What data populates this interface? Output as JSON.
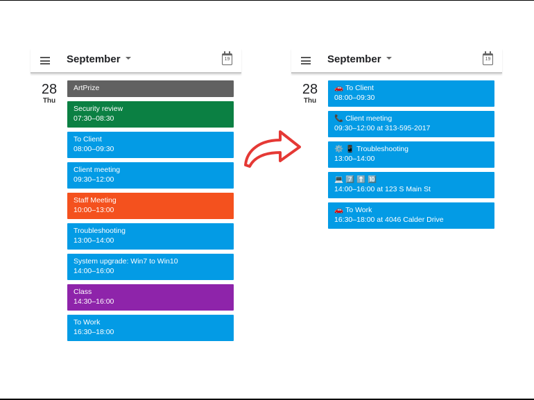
{
  "colors": {
    "graphite": "#616161",
    "basil": "#0b8043",
    "peacock": "#039be5",
    "tangerine": "#f4511e",
    "grape": "#8e24aa",
    "arrow": "#e53935"
  },
  "left": {
    "header": {
      "month": "September",
      "calendar_icon_day": "19"
    },
    "day": {
      "number": "28",
      "name": "Thu"
    },
    "events": [
      {
        "title": "ArtPrize",
        "time": "",
        "color": "#616161"
      },
      {
        "title": "Security review",
        "time": "07:30–08:30",
        "color": "#0b8043"
      },
      {
        "title": "To Client",
        "time": "08:00–09:30",
        "color": "#039be5"
      },
      {
        "title": "Client meeting",
        "time": "09:30–12:00",
        "color": "#039be5"
      },
      {
        "title": "Staff Meeting",
        "time": "10:00–13:00",
        "color": "#f4511e"
      },
      {
        "title": "Troubleshooting",
        "time": "13:00–14:00",
        "color": "#039be5"
      },
      {
        "title": "System upgrade: Win7 to Win10",
        "time": "14:00–16:00",
        "color": "#039be5"
      },
      {
        "title": "Class",
        "time": "14:30–16:00",
        "color": "#8e24aa"
      },
      {
        "title": "To Work",
        "time": "16:30–18:00",
        "color": "#039be5"
      }
    ]
  },
  "right": {
    "header": {
      "month": "September",
      "calendar_icon_day": "19"
    },
    "day": {
      "number": "28",
      "name": "Thu"
    },
    "events": [
      {
        "icons": "🚗",
        "title": "To Client",
        "time": "08:00–09:30",
        "color": "#039be5"
      },
      {
        "icons": "📞",
        "title": "Client meeting",
        "time": "09:30–12:00 at 313-595-2017",
        "color": "#039be5"
      },
      {
        "icons": "⚙️ 📱",
        "title": "Troubleshooting",
        "time": "13:00–14:00",
        "color": "#039be5"
      },
      {
        "icons": "💻 7️⃣ ⬆️ 🔟",
        "title": "",
        "time": "14:00–16:00 at 123 S Main St",
        "color": "#039be5"
      },
      {
        "icons": "🚗",
        "title": "To Work",
        "time": "16:30–18:00 at 4046 Calder Drive",
        "color": "#039be5"
      }
    ]
  }
}
